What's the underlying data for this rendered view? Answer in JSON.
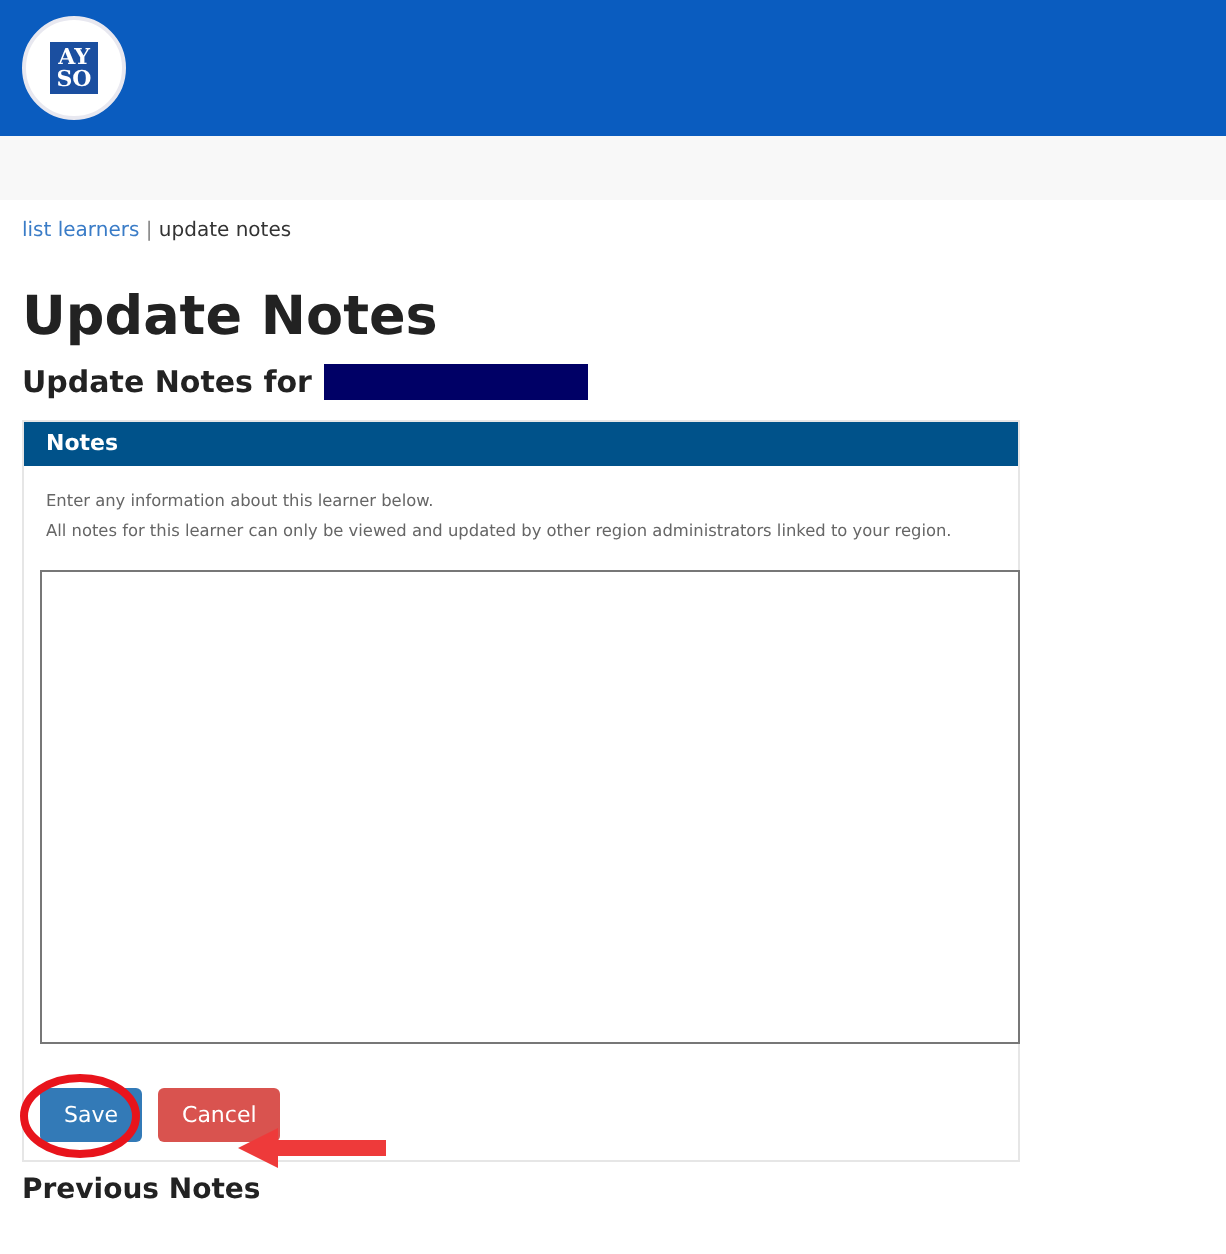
{
  "header": {
    "logo_lines": [
      "AY",
      "SO"
    ]
  },
  "breadcrumb": [
    {
      "label": "list learners",
      "kind": "link"
    },
    {
      "label": "|",
      "kind": "separator"
    },
    {
      "label": "update notes",
      "kind": "current"
    }
  ],
  "title": "Update Notes",
  "subtitle": {
    "text": "Update Notes for",
    "redacted": true
  },
  "panel": {
    "title": "Notes",
    "info": [
      "Enter any information about this learner below.",
      "All notes for this learner can only be viewed and updated by other region administrators linked to your region."
    ],
    "buttons": [
      {
        "label": "Save",
        "kind": "primary",
        "highlighted": true
      },
      {
        "label": "Cancel",
        "kind": "danger",
        "highlighted": false
      }
    ]
  },
  "section": "Previous Notes"
}
